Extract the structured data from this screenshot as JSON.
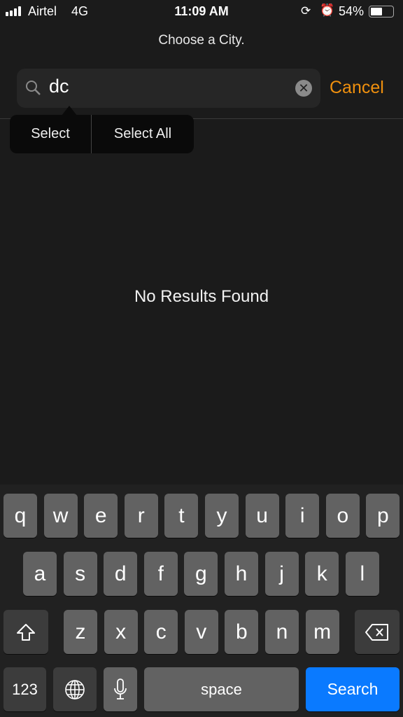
{
  "status": {
    "carrier": "Airtel",
    "network": "4G",
    "time": "11:09 AM",
    "battery": "54%",
    "battery_level": 0.54,
    "icons": [
      "signal-icon",
      "rotation-lock-icon",
      "alarm-icon",
      "battery-icon"
    ]
  },
  "title": "Choose a City.",
  "search": {
    "value": "dc",
    "icon": "search-icon",
    "clear_icon": "clear-icon",
    "cancel": "Cancel"
  },
  "context_menu": {
    "select": "Select",
    "select_all": "Select All"
  },
  "empty_state": "No Results Found",
  "colors": {
    "accent": "#f0900e",
    "search_key": "#0a7aff",
    "background": "#1b1b1b"
  },
  "keyboard": {
    "rows": [
      [
        "q",
        "w",
        "e",
        "r",
        "t",
        "y",
        "u",
        "i",
        "o",
        "p"
      ],
      [
        "a",
        "s",
        "d",
        "f",
        "g",
        "h",
        "j",
        "k",
        "l"
      ],
      [
        "z",
        "x",
        "c",
        "v",
        "b",
        "n",
        "m"
      ]
    ],
    "shift": "shift-icon",
    "delete": "delete-icon",
    "numbers": "123",
    "globe": "globe-icon",
    "mic": "microphone-icon",
    "space": "space",
    "search": "Search"
  }
}
